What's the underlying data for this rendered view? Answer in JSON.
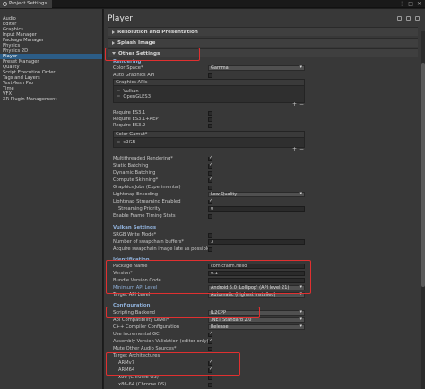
{
  "window": {
    "tab_title": "Project Settings",
    "controls": [
      "⋮",
      "□",
      "✕"
    ]
  },
  "sidebar": {
    "items": [
      {
        "label": "Audio",
        "active": false
      },
      {
        "label": "Editor",
        "active": false
      },
      {
        "label": "Graphics",
        "active": false
      },
      {
        "label": "Input Manager",
        "active": false
      },
      {
        "label": "Package Manager",
        "active": false
      },
      {
        "label": "Physics",
        "active": false
      },
      {
        "label": "Physics 2D",
        "active": false
      },
      {
        "label": "Player",
        "active": true
      },
      {
        "label": "Preset Manager",
        "active": false
      },
      {
        "label": "Quality",
        "active": false
      },
      {
        "label": "Script Execution Order",
        "active": false
      },
      {
        "label": "Tags and Layers",
        "active": false
      },
      {
        "label": "TextMesh Pro",
        "active": false
      },
      {
        "label": "Time",
        "active": false
      },
      {
        "label": "VFX",
        "active": false
      },
      {
        "label": "XR Plugin Management",
        "active": false
      }
    ]
  },
  "main": {
    "title": "Player",
    "sections": {
      "resolution": "Resolution and Presentation",
      "splash": "Splash Image",
      "other": "Other Settings"
    },
    "rendering": {
      "header": "Rendering",
      "color_space_label": "Color Space*",
      "color_space_value": "Gamma",
      "auto_graphics_label": "Auto Graphics API",
      "graphics_apis_header": "Graphics APIs",
      "graphics_apis": [
        "Vulkan",
        "OpenGLES3"
      ],
      "require_es31": "Require ES3.1",
      "require_es31_aep": "Require ES3.1+AEP",
      "require_es32": "Require ES3.2",
      "color_gamut_header": "Color Gamut*",
      "color_gamut": [
        "sRGB"
      ],
      "mt_rendering": "Multithreaded Rendering*",
      "static_batching": "Static Batching",
      "dynamic_batching": "Dynamic Batching",
      "compute_skinning": "Compute Skinning*",
      "graphics_jobs": "Graphics Jobs (Experimental)",
      "lightmap_encoding_label": "Lightmap Encoding",
      "lightmap_encoding_value": "Low Quality",
      "lightmap_streaming": "Lightmap Streaming Enabled",
      "streaming_priority_label": "Streaming Priority",
      "streaming_priority_value": "0",
      "frame_timing": "Enable Frame Timing Stats"
    },
    "vulkan": {
      "header": "Vulkan Settings",
      "srgb_write": "SRGB Write Mode*",
      "swapchain_label": "Number of swapchain buffers*",
      "swapchain_value": "3",
      "acquire_late": "Acquire swapchain image late as possible*"
    },
    "identification": {
      "header": "Identification",
      "package_name_label": "Package Name",
      "package_name_value": "com.cfarm.hello",
      "version_label": "Version*",
      "version_value": "0.1",
      "bundle_code_label": "Bundle Version Code",
      "bundle_code_value": "1",
      "min_api_label": "Minimum API Level",
      "min_api_value": "Android 5.0 'Lollipop' (API level 21)",
      "target_api_label": "Target API Level",
      "target_api_value": "Automatic (highest installed)"
    },
    "configuration": {
      "header": "Configuration",
      "scripting_backend_label": "Scripting Backend",
      "scripting_backend_value": "IL2CPP",
      "api_compat_label": "Api Compatibility Level*",
      "api_compat_value": ".NET Standard 2.0",
      "cpp_compiler_label": "C++ Compiler Configuration",
      "cpp_compiler_value": "Release",
      "incremental_gc": "Use incremental GC",
      "assembly_validation": "Assembly Version Validation (editor only)",
      "mute_audio": "Mute Other Audio Sources*",
      "target_arch_label": "Target Architectures",
      "armv7": "ARMv7",
      "arm64": "ARM64",
      "x86": "x86 (Chrome OS)",
      "x86_64": "x86-64 (Chrome OS)"
    }
  }
}
